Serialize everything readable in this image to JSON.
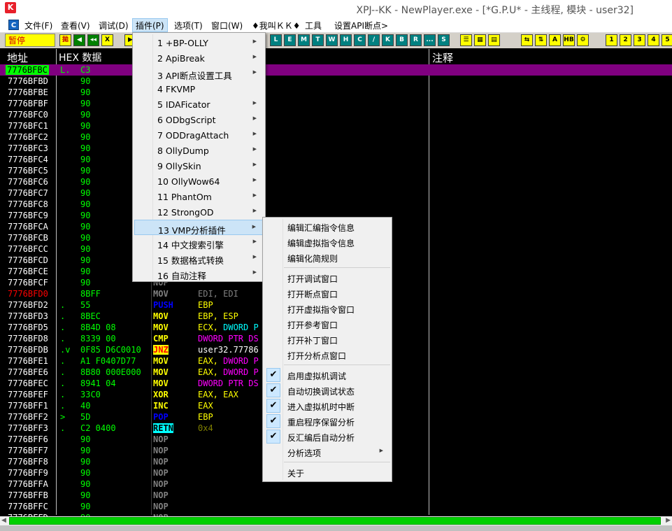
{
  "window": {
    "title": "XPJ--KK - NewPlayer.exe - [*G.P.U* -  主线程, 模块 - user32]",
    "icon": "app-k-icon"
  },
  "menubar": {
    "items": [
      "文件(F)",
      "查看(V)",
      "调试(D)",
      "插件(P)",
      "选项(T)",
      "窗口(W)",
      "♦我叫ＫＫ♦",
      "工具",
      "设置API断点>"
    ]
  },
  "toolbar": {
    "pause_label": "暂停",
    "buttons": [
      {
        "t": "拋",
        "c": "#ffff00",
        "f": "#c00000"
      },
      {
        "t": "◀",
        "c": "#008000"
      },
      {
        "t": "◂◂",
        "c": "#008000"
      },
      {
        "t": "X",
        "c": "#ffff00",
        "f": "#000"
      },
      {
        "t": "▶",
        "c": "#ffff00",
        "f": "#000"
      },
      {
        "t": "L",
        "c": "#008080"
      },
      {
        "t": "E",
        "c": "#008080"
      },
      {
        "t": "M",
        "c": "#008080"
      },
      {
        "t": "T",
        "c": "#008080"
      },
      {
        "t": "W",
        "c": "#008080"
      },
      {
        "t": "H",
        "c": "#008080"
      },
      {
        "t": "C",
        "c": "#008080"
      },
      {
        "t": "/",
        "c": "#008080"
      },
      {
        "t": "K",
        "c": "#008080"
      },
      {
        "t": "B",
        "c": "#008080"
      },
      {
        "t": "R",
        "c": "#008080"
      },
      {
        "t": "...",
        "c": "#008080"
      },
      {
        "t": "S",
        "c": "#008080"
      },
      {
        "t": "☰",
        "c": "#ffff00",
        "f": "#000"
      },
      {
        "t": "▦",
        "c": "#ffff00",
        "f": "#000"
      },
      {
        "t": "▤",
        "c": "#ffff00",
        "f": "#000"
      },
      {
        "t": "⇆",
        "c": "#ffff00",
        "f": "#000"
      },
      {
        "t": "⇅",
        "c": "#ffff00",
        "f": "#000"
      },
      {
        "t": "A",
        "c": "#ffff00",
        "f": "#000"
      },
      {
        "t": "HB",
        "c": "#ffff00",
        "f": "#000"
      },
      {
        "t": "⚙",
        "c": "#ffff00",
        "f": "#000"
      },
      {
        "t": "1",
        "c": "#ffff00",
        "f": "#000"
      },
      {
        "t": "2",
        "c": "#ffff00",
        "f": "#000"
      },
      {
        "t": "3",
        "c": "#ffff00",
        "f": "#000"
      },
      {
        "t": "4",
        "c": "#ffff00",
        "f": "#000"
      },
      {
        "t": "5",
        "c": "#ffff00",
        "f": "#000"
      }
    ]
  },
  "columns": {
    "address": "地址",
    "hex": "HEX 数据",
    "comment": "注释"
  },
  "rows": [
    {
      "a": "7776BFBC",
      "m": "L.",
      "h": "C3",
      "i": "",
      "o": "",
      "sel": true
    },
    {
      "a": "7776BFBD",
      "m": "",
      "h": "90",
      "i": "",
      "o": ""
    },
    {
      "a": "7776BFBE",
      "m": "",
      "h": "90",
      "i": "",
      "o": ""
    },
    {
      "a": "7776BFBF",
      "m": "",
      "h": "90",
      "i": "",
      "o": ""
    },
    {
      "a": "7776BFC0",
      "m": "",
      "h": "90",
      "i": "",
      "o": ""
    },
    {
      "a": "7776BFC1",
      "m": "",
      "h": "90",
      "i": "",
      "o": ""
    },
    {
      "a": "7776BFC2",
      "m": "",
      "h": "90",
      "i": "",
      "o": ""
    },
    {
      "a": "7776BFC3",
      "m": "",
      "h": "90",
      "i": "",
      "o": ""
    },
    {
      "a": "7776BFC4",
      "m": "",
      "h": "90",
      "i": "",
      "o": ""
    },
    {
      "a": "7776BFC5",
      "m": "",
      "h": "90",
      "i": "",
      "o": ""
    },
    {
      "a": "7776BFC6",
      "m": "",
      "h": "90",
      "i": "",
      "o": ""
    },
    {
      "a": "7776BFC7",
      "m": "",
      "h": "90",
      "i": "",
      "o": ""
    },
    {
      "a": "7776BFC8",
      "m": "",
      "h": "90",
      "i": "",
      "o": ""
    },
    {
      "a": "7776BFC9",
      "m": "",
      "h": "90",
      "i": "",
      "o": ""
    },
    {
      "a": "7776BFCA",
      "m": "",
      "h": "90",
      "i": "",
      "o": ""
    },
    {
      "a": "7776BFCB",
      "m": "",
      "h": "90",
      "i": "",
      "o": ""
    },
    {
      "a": "7776BFCC",
      "m": "",
      "h": "90",
      "i": "",
      "o": ""
    },
    {
      "a": "7776BFCD",
      "m": "",
      "h": "90",
      "i": "",
      "o": ""
    },
    {
      "a": "7776BFCE",
      "m": "",
      "h": "90",
      "i": "",
      "o": ""
    },
    {
      "a": "7776BFCF",
      "m": "",
      "h": "90",
      "i": "NOP",
      "o": ""
    },
    {
      "a": "7776BFD0",
      "m": "",
      "h": "8BFF",
      "i": "MOV",
      "o": "EDI, EDI",
      "ac": "#ff0000",
      "ic": "#808080",
      "oc": "#808080"
    },
    {
      "a": "7776BFD2",
      "m": ".",
      "h": "55",
      "i": "PUSH",
      "o": "EBP",
      "ic": "#0000ff",
      "oc": "#ffff00"
    },
    {
      "a": "7776BFD3",
      "m": ".",
      "h": "8BEC",
      "i": "MOV",
      "o": "EBP, ESP",
      "ic": "#ffff00",
      "oc": "#ffff00"
    },
    {
      "a": "7776BFD5",
      "m": ".",
      "h": "8B4D 08",
      "i": "MOV",
      "o": "ECX, DWORD P",
      "ic": "#ffff00",
      "oc": "#ffff00",
      "o2": "DWORD P",
      "o2c": "#00ffff"
    },
    {
      "a": "7776BFD8",
      "m": ".",
      "h": "8339 00",
      "i": "CMP",
      "o": "DWORD PTR DS",
      "ic": "#ffff00",
      "oc": "#ff00ff"
    },
    {
      "a": "7776BFDB",
      "m": ".v",
      "h": "0F85 D6C0010",
      "i": "JNZ",
      "o": "user32.77786",
      "ic": "#ff0000",
      "ibg": "#ffff00",
      "oc": "#ffffff"
    },
    {
      "a": "7776BFE1",
      "m": ".",
      "h": "A1 F0407D77",
      "i": "MOV",
      "o": "EAX, DWORD P",
      "ic": "#ffff00",
      "oc": "#ffff00",
      "o2": "DWORD P",
      "o2c": "#ff00ff"
    },
    {
      "a": "7776BFE6",
      "m": ".",
      "h": "8B80 000E000",
      "i": "MOV",
      "o": "EAX, DWORD P",
      "ic": "#ffff00",
      "oc": "#ffff00",
      "o2": "DWORD P",
      "o2c": "#ff00ff"
    },
    {
      "a": "7776BFEC",
      "m": ".",
      "h": "8941 04",
      "i": "MOV",
      "o": "DWORD PTR DS",
      "ic": "#ffff00",
      "oc": "#ff00ff"
    },
    {
      "a": "7776BFEF",
      "m": ".",
      "h": "33C0",
      "i": "XOR",
      "o": "EAX, EAX",
      "ic": "#ffff00",
      "oc": "#ffff00"
    },
    {
      "a": "7776BFF1",
      "m": ".",
      "h": "40",
      "i": "INC",
      "o": "EAX",
      "ic": "#ffff00",
      "oc": "#ffff00"
    },
    {
      "a": "7776BFF2",
      "m": ">",
      "h": "5D",
      "i": "POP",
      "o": "EBP",
      "ic": "#0000ff",
      "oc": "#ffff00"
    },
    {
      "a": "7776BFF3",
      "m": ".",
      "h": "C2 0400",
      "i": "RETN",
      "o": "0x4",
      "ic": "#000000",
      "ibg": "#00ffff",
      "oc": "#808000"
    },
    {
      "a": "7776BFF6",
      "m": "",
      "h": "90",
      "i": "NOP",
      "o": ""
    },
    {
      "a": "7776BFF7",
      "m": "",
      "h": "90",
      "i": "NOP",
      "o": ""
    },
    {
      "a": "7776BFF8",
      "m": "",
      "h": "90",
      "i": "NOP",
      "o": ""
    },
    {
      "a": "7776BFF9",
      "m": "",
      "h": "90",
      "i": "NOP",
      "o": ""
    },
    {
      "a": "7776BFFA",
      "m": "",
      "h": "90",
      "i": "NOP",
      "o": ""
    },
    {
      "a": "7776BFFB",
      "m": "",
      "h": "90",
      "i": "NOP",
      "o": ""
    },
    {
      "a": "7776BFFC",
      "m": "",
      "h": "90",
      "i": "NOP",
      "o": ""
    },
    {
      "a": "7776BFFD",
      "m": "",
      "h": "90",
      "i": "NOP",
      "o": ""
    }
  ],
  "plugin_menu": [
    {
      "label": "1 +BP-OLLY",
      "sub": true
    },
    {
      "label": "2 ApiBreak",
      "sub": true
    },
    {
      "label": "3 API断点设置工具",
      "sub": true
    },
    {
      "label": "4 FKVMP",
      "sub": false
    },
    {
      "label": "5 IDAFicator",
      "sub": true
    },
    {
      "label": "6 ODbgScript",
      "sub": true
    },
    {
      "label": "7 ODDragAttach",
      "sub": true
    },
    {
      "label": "8 OllyDump",
      "sub": true
    },
    {
      "label": "9 OllySkin",
      "sub": true
    },
    {
      "label": "10 OllyWow64",
      "sub": true
    },
    {
      "label": "11 PhantOm",
      "sub": true
    },
    {
      "label": "12 StrongOD",
      "sub": true
    },
    {
      "label": "13 VMP分析插件",
      "sub": true,
      "hl": true
    },
    {
      "label": "14 中文搜索引擎",
      "sub": true
    },
    {
      "label": "15 数据格式转换",
      "sub": true
    },
    {
      "label": "16 自动注释",
      "sub": true
    }
  ],
  "vmp_menu": [
    {
      "label": "编辑汇编指令信息"
    },
    {
      "label": "编辑虚拟指令信息"
    },
    {
      "label": "编辑化简规则"
    },
    {
      "sep": true
    },
    {
      "label": "打开调试窗口"
    },
    {
      "label": "打开断点窗口"
    },
    {
      "label": "打开虚拟指令窗口"
    },
    {
      "label": "打开参考窗口"
    },
    {
      "label": "打开补丁窗口"
    },
    {
      "label": "打开分析点窗口"
    },
    {
      "sep": true
    },
    {
      "label": "启用虚拟机调试",
      "check": true
    },
    {
      "label": "自动切换调试状态",
      "check": true
    },
    {
      "label": "进入虚拟机时中断",
      "check": true
    },
    {
      "label": "重启程序保留分析",
      "check": true
    },
    {
      "label": "反汇编后自动分析",
      "check": true
    },
    {
      "label": "分析选项",
      "sub": true
    },
    {
      "sep": true
    },
    {
      "label": "关于"
    }
  ]
}
